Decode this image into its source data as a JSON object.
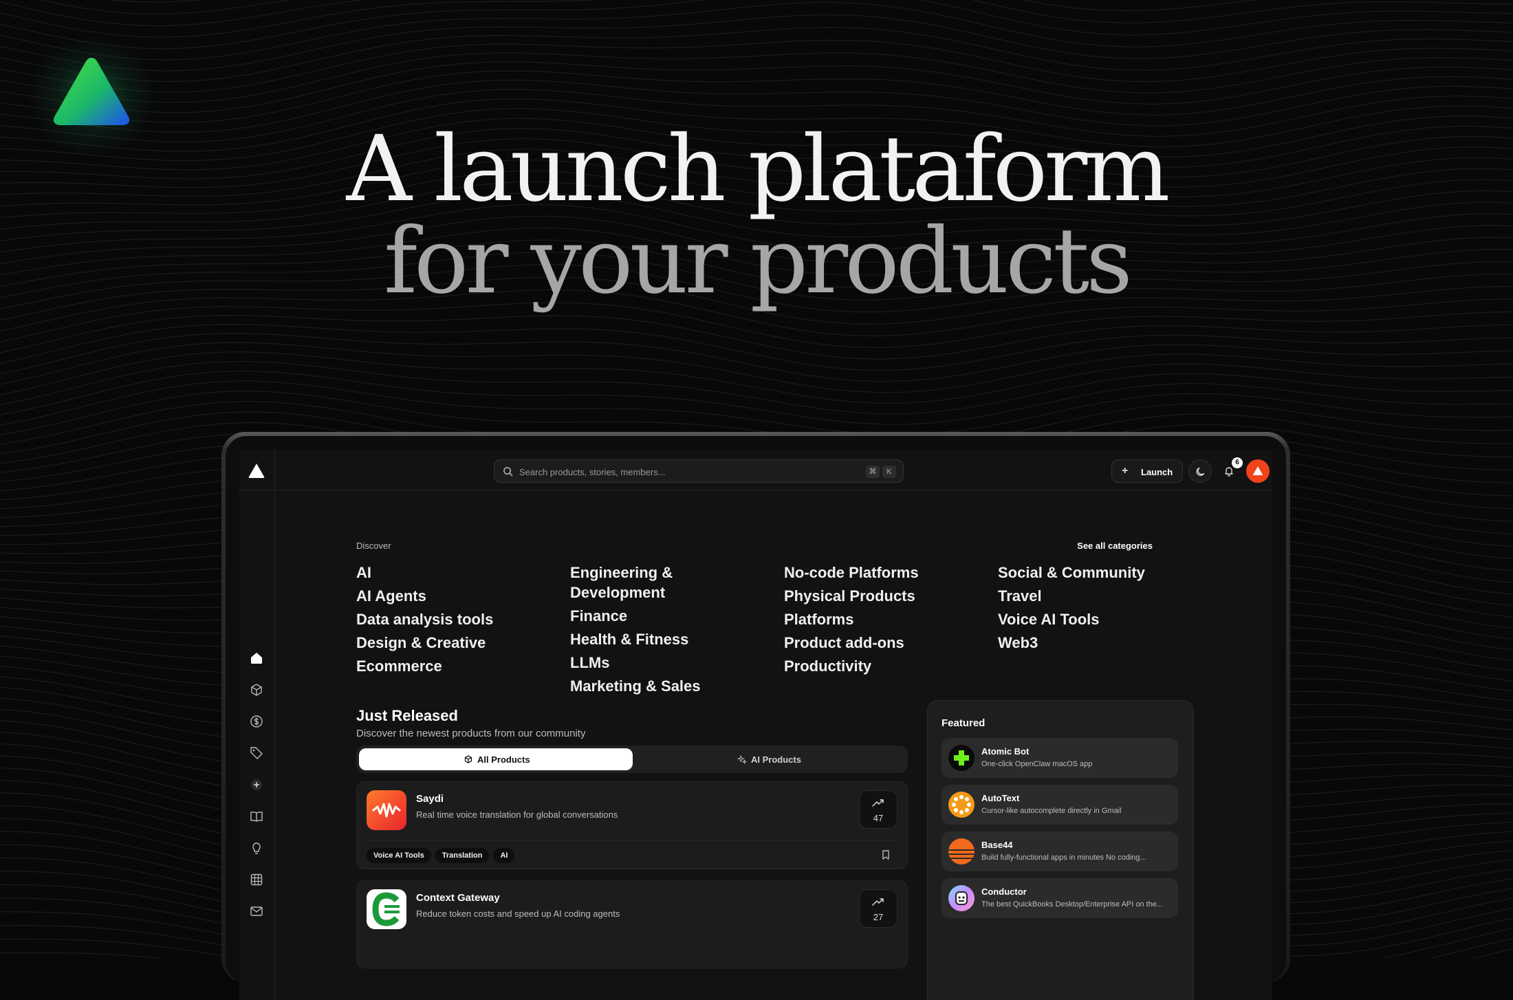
{
  "hero": {
    "line1": "A launch plataform",
    "line2": "for your products"
  },
  "colors": {
    "background": "#080808",
    "brand_gradient": [
      "#37d04a",
      "#1e5cf0"
    ],
    "accent_orange": "#f0431c",
    "app_surface": "#121212"
  },
  "topbar": {
    "search_placeholder": "Search products, stories, members...",
    "shortcut_keys": [
      "⌘",
      "K"
    ],
    "launch_label": "Launch",
    "notification_count": "6"
  },
  "sidebar": {
    "icons": [
      "home-icon",
      "box-icon",
      "dollar-icon",
      "tag-icon",
      "plus-circle-icon",
      "book-icon",
      "lightbulb-icon",
      "grid-icon",
      "mail-icon"
    ]
  },
  "discover": {
    "label": "Discover",
    "see_all": "See all categories",
    "columns": [
      [
        "AI",
        "AI Agents",
        "Data analysis tools",
        "Design & Creative",
        "Ecommerce"
      ],
      [
        "Engineering & Development",
        "Finance",
        "Health & Fitness",
        "LLMs",
        "Marketing & Sales"
      ],
      [
        "No-code Platforms",
        "Physical Products",
        "Platforms",
        "Product add-ons",
        "Productivity"
      ],
      [
        "Social & Community",
        "Travel",
        "Voice AI Tools",
        "Web3"
      ]
    ]
  },
  "just_released": {
    "title": "Just Released",
    "subtitle": "Discover the newest products from our community",
    "tabs": [
      "All Products",
      "AI Products"
    ],
    "products": [
      {
        "name": "Saydi",
        "description": "Real time voice translation for global conversations",
        "votes": "47",
        "tags": [
          "Voice AI Tools",
          "Translation",
          "AI"
        ]
      },
      {
        "name": "Context Gateway",
        "description": "Reduce token costs and speed up AI coding agents",
        "votes": "27",
        "tags": []
      }
    ]
  },
  "featured": {
    "title": "Featured",
    "items": [
      {
        "name": "Atomic Bot",
        "description": "One-click OpenClaw macOS app"
      },
      {
        "name": "AutoText",
        "description": "Cursor-like autocomplete directly in Gmail"
      },
      {
        "name": "Base44",
        "description": "Build fully-functional apps in minutes No coding..."
      },
      {
        "name": "Conductor",
        "description": "The best QuickBooks Desktop/Enterprise API on the..."
      }
    ]
  }
}
